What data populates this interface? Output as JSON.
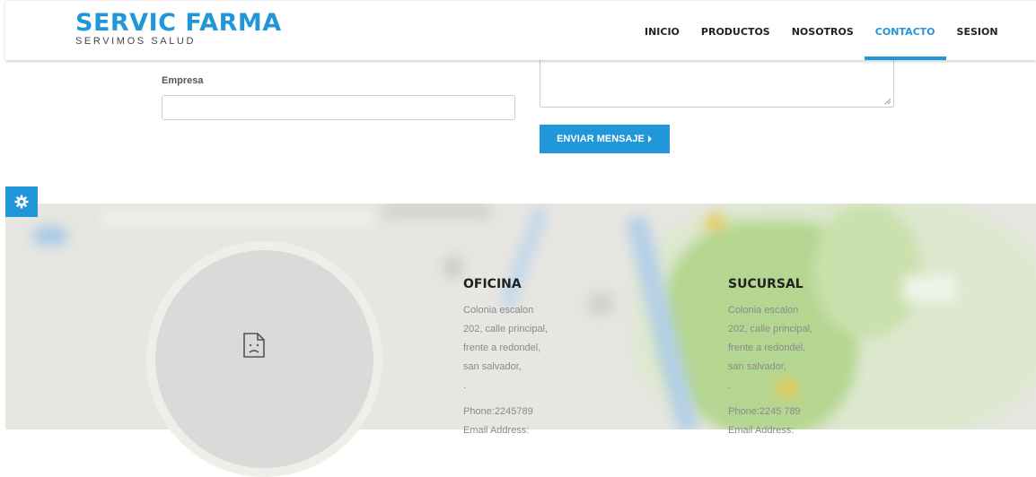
{
  "brand": {
    "name": "SERVIC FARMA",
    "tagline": "SERVIMOS SALUD",
    "color": "#2196d8"
  },
  "nav": {
    "items": [
      {
        "label": "INICIO",
        "active": false
      },
      {
        "label": "PRODUCTOS",
        "active": false
      },
      {
        "label": "NOSOTROS",
        "active": false
      },
      {
        "label": "CONTACTO",
        "active": true
      },
      {
        "label": "SESION",
        "active": false
      }
    ]
  },
  "form": {
    "empresa_label": "Empresa",
    "empresa_value": "",
    "message_value": "",
    "send_label": "ENVIAR MENSAJE"
  },
  "settings": {
    "icon": "gear-icon"
  },
  "map": {
    "photo_icon": "broken-image-icon",
    "offices": [
      {
        "title": "OFICINA",
        "address": [
          "Colonia escalon",
          "202, calle principal,",
          "frente a redondel,",
          "san salvador,",
          "."
        ],
        "phone": "Phone:2245789",
        "email_label": "Email Address:"
      },
      {
        "title": "SUCURSAL",
        "address": [
          "Colonia escalon",
          "202, calle principal,",
          "frente a redondel,",
          "san salvador,",
          "."
        ],
        "phone": "Phone:2245 789",
        "email_label": "Email Address:"
      }
    ]
  }
}
